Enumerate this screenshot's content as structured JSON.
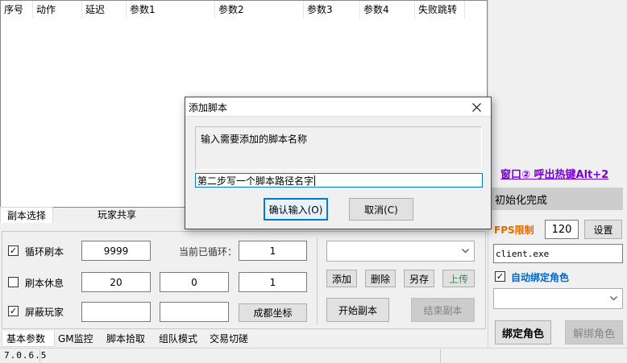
{
  "table": {
    "columns": [
      "序号",
      "动作",
      "延迟",
      "参数1",
      "参数2",
      "参数3",
      "参数4",
      "失败跳转"
    ]
  },
  "upper_tabs": [
    "副本选择",
    "玩家共享"
  ],
  "loop": {
    "loop_label": "循环刷本",
    "loop_checked": true,
    "loop_count": "9999",
    "current_loop_label": "当前已循环：",
    "current_loop_value": "1",
    "rest_label": "刷本休息",
    "rest_checked": false,
    "rest_a": "20",
    "rest_b": "0",
    "rest_c": "1",
    "block_label": "屏蔽玩家",
    "block_checked": true,
    "block_a": "",
    "block_b": "",
    "coords_button": "成都坐标"
  },
  "script_actions": {
    "add": "添加",
    "delete": "删除",
    "save_as": "另存",
    "upload": "上传",
    "start": "开始副本",
    "end": "结束副本"
  },
  "bottom_tabs": [
    "基本参数",
    "GM监控",
    "脚本拾取",
    "组队模式",
    "交易切磋"
  ],
  "status": {
    "version": "7.0.6.5"
  },
  "right_panel": {
    "hotkey_link": "窗口② 呼出热键Alt+2",
    "init_status": "初始化完成",
    "fps_label": "FPS限制",
    "fps_value": "120",
    "settings_button": "设置",
    "process_name": "client.exe",
    "auto_bind_label": "自动绑定角色",
    "auto_bind_checked": true,
    "bind_button": "绑定角色",
    "unbind_button": "解绑角色"
  },
  "dialog": {
    "title": "添加脚本",
    "prompt": "输入需要添加的脚本名称",
    "input_value": "第二步写一个脚本路径名字",
    "confirm_button": "确认输入(O)",
    "cancel_button": "取消(C)"
  },
  "colors": {
    "hotkey_purple": "#7a00cc",
    "fps_orange": "#e06c00",
    "auto_bind_blue": "#0066cc",
    "upload_green": "#2e8b57"
  }
}
